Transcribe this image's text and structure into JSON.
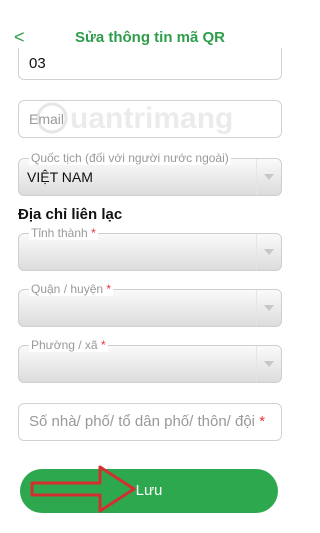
{
  "header": {
    "title": "Sửa thông tin mã QR",
    "back_glyph": "<"
  },
  "fields": {
    "top_value": "03",
    "email_placeholder": "Email",
    "nationality_label": "Quốc tịch (đối với người nước ngoài)",
    "nationality_value": "VIỆT NAM"
  },
  "address": {
    "section_title": "Địa chỉ liên lạc",
    "province_label": "Tỉnh thành",
    "district_label": "Quận / huyện",
    "ward_label": "Phường / xã",
    "street_placeholder": "Số nhà/ phố/ tổ dân phố/ thôn/ đội",
    "required_mark": "*"
  },
  "actions": {
    "save_label": "Lưu"
  },
  "watermark": {
    "text": "Quantrimang"
  },
  "colors": {
    "brand_green": "#2ea84f",
    "required_red": "#e53935",
    "annotation_red": "#d32f2f"
  }
}
